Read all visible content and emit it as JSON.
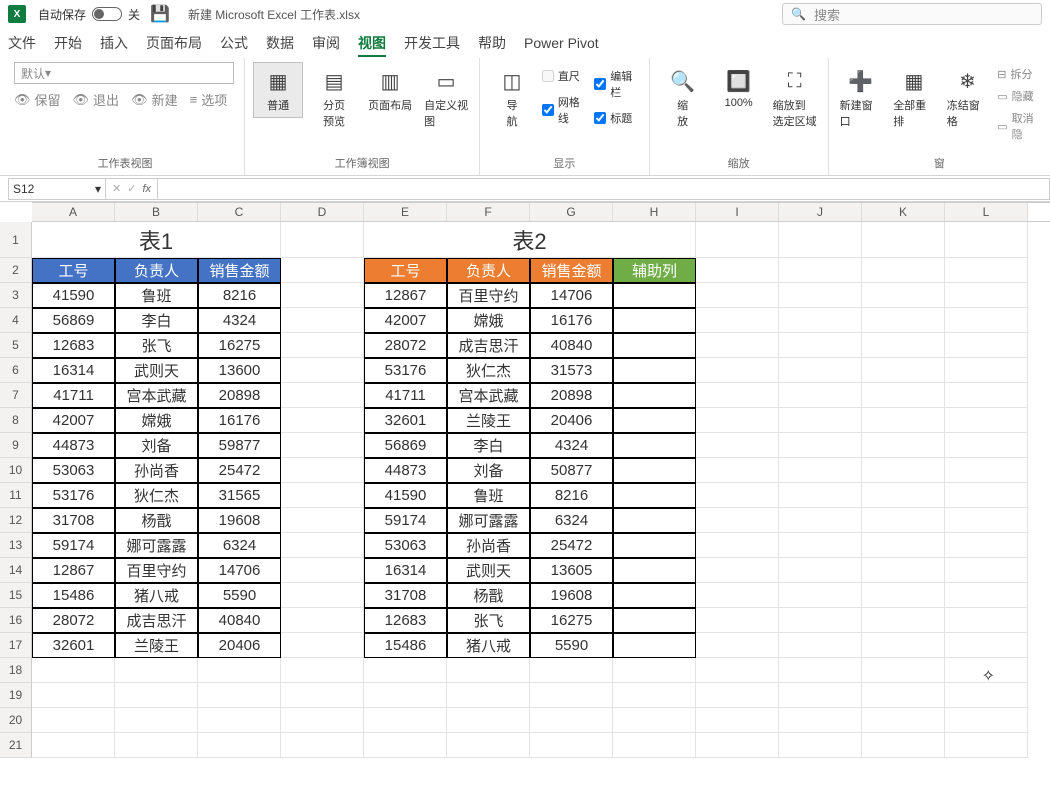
{
  "title_bar": {
    "autosave_label": "自动保存",
    "autosave_state": "关",
    "file_name": "新建 Microsoft Excel 工作表.xlsx",
    "search_placeholder": "搜索"
  },
  "tabs": [
    "文件",
    "开始",
    "插入",
    "页面布局",
    "公式",
    "数据",
    "审阅",
    "视图",
    "开发工具",
    "帮助",
    "Power Pivot"
  ],
  "active_tab_index": 7,
  "ribbon": {
    "group1": {
      "label": "工作表视图",
      "default_text": "默认",
      "keep": "保留",
      "exit": "退出",
      "new": "新建",
      "options": "选项"
    },
    "group2": {
      "label": "工作簿视图",
      "normal": "普通",
      "page_break": "分页\n预览",
      "page_layout": "页面布局",
      "custom_view": "自定义视图"
    },
    "group3": {
      "label": "显示",
      "nav": "导\n航",
      "ruler": "直尺",
      "formula_bar": "编辑栏",
      "gridlines": "网格线",
      "headings": "标题"
    },
    "group4": {
      "label": "缩放",
      "zoom": "缩\n放",
      "hundred": "100%",
      "zoom_sel": "缩放到\n选定区域"
    },
    "group5": {
      "new_window": "新建窗口",
      "arrange": "全部重排",
      "freeze": "冻结窗格"
    },
    "group6": {
      "split": "拆分",
      "hide": "隐藏",
      "unhide": "取消隐"
    }
  },
  "name_box": "S12",
  "columns": [
    "A",
    "B",
    "C",
    "D",
    "E",
    "F",
    "G",
    "H",
    "I",
    "J",
    "K",
    "L"
  ],
  "row_numbers": [
    1,
    2,
    3,
    4,
    5,
    6,
    7,
    8,
    9,
    10,
    11,
    12,
    13,
    14,
    15,
    16,
    17,
    18,
    19,
    20,
    21
  ],
  "table1": {
    "title": "表1",
    "headers": [
      "工号",
      "负责人",
      "销售金额"
    ],
    "rows": [
      [
        "41590",
        "鲁班",
        "8216"
      ],
      [
        "56869",
        "李白",
        "4324"
      ],
      [
        "12683",
        "张飞",
        "16275"
      ],
      [
        "16314",
        "武则天",
        "13600"
      ],
      [
        "41711",
        "宫本武藏",
        "20898"
      ],
      [
        "42007",
        "嫦娥",
        "16176"
      ],
      [
        "44873",
        "刘备",
        "59877"
      ],
      [
        "53063",
        "孙尚香",
        "25472"
      ],
      [
        "53176",
        "狄仁杰",
        "31565"
      ],
      [
        "31708",
        "杨戬",
        "19608"
      ],
      [
        "59174",
        "娜可露露",
        "6324"
      ],
      [
        "12867",
        "百里守约",
        "14706"
      ],
      [
        "15486",
        "猪八戒",
        "5590"
      ],
      [
        "28072",
        "成吉思汗",
        "40840"
      ],
      [
        "32601",
        "兰陵王",
        "20406"
      ]
    ]
  },
  "table2": {
    "title": "表2",
    "headers": [
      "工号",
      "负责人",
      "销售金额",
      "辅助列"
    ],
    "rows": [
      [
        "12867",
        "百里守约",
        "14706"
      ],
      [
        "42007",
        "嫦娥",
        "16176"
      ],
      [
        "28072",
        "成吉思汗",
        "40840"
      ],
      [
        "53176",
        "狄仁杰",
        "31573"
      ],
      [
        "41711",
        "宫本武藏",
        "20898"
      ],
      [
        "32601",
        "兰陵王",
        "20406"
      ],
      [
        "56869",
        "李白",
        "4324"
      ],
      [
        "44873",
        "刘备",
        "50877"
      ],
      [
        "41590",
        "鲁班",
        "8216"
      ],
      [
        "59174",
        "娜可露露",
        "6324"
      ],
      [
        "53063",
        "孙尚香",
        "25472"
      ],
      [
        "16314",
        "武则天",
        "13605"
      ],
      [
        "31708",
        "杨戬",
        "19608"
      ],
      [
        "12683",
        "张飞",
        "16275"
      ],
      [
        "15486",
        "猪八戒",
        "5590"
      ]
    ]
  }
}
